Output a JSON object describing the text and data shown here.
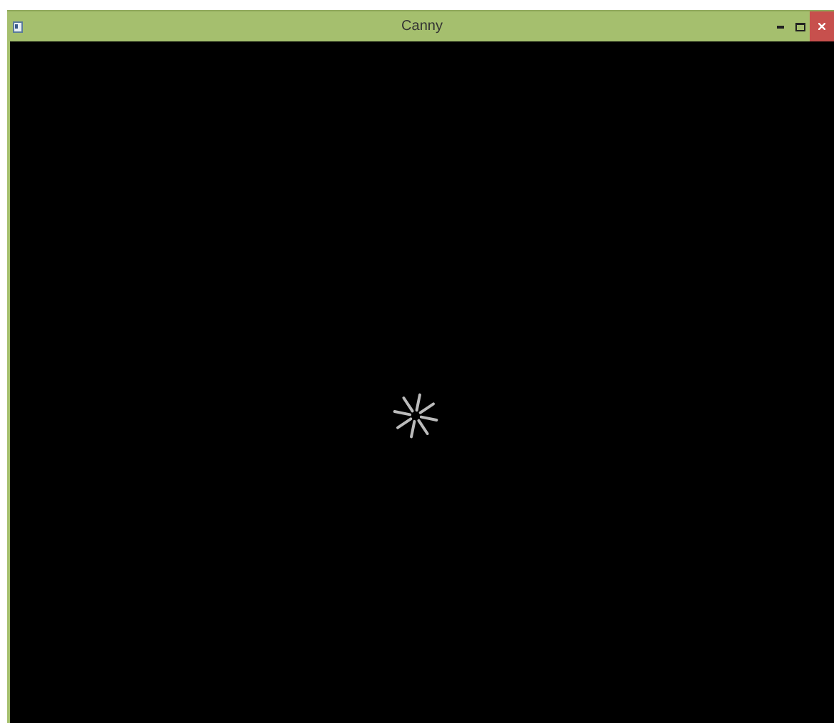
{
  "window": {
    "title": "Canny"
  }
}
